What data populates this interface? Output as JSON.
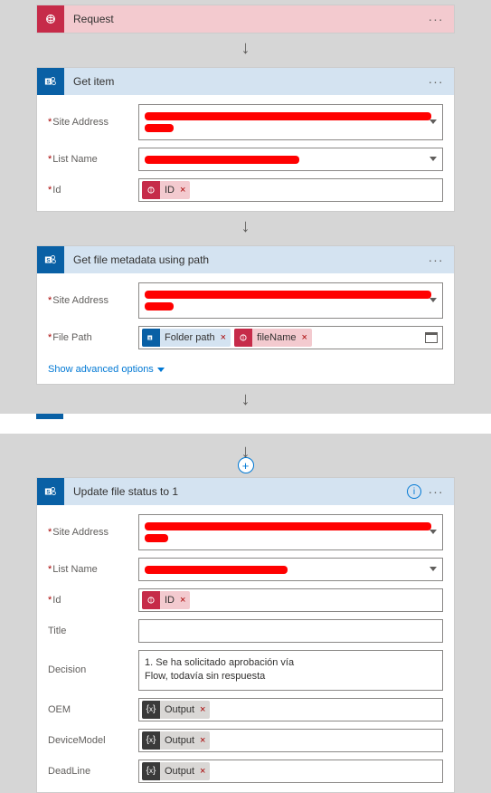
{
  "request": {
    "title": "Request"
  },
  "getItem": {
    "title": "Get item",
    "f_site": "Site Address",
    "f_list": "List Name",
    "f_id": "Id",
    "pill_id": "ID"
  },
  "getMeta": {
    "title": "Get file metadata using path",
    "f_site": "Site Address",
    "f_path": "File Path",
    "pill_folder": "Folder path",
    "pill_file": "fileName",
    "adv": "Show advanced options"
  },
  "update": {
    "title": "Update file status to 1",
    "f_site": "Site Address",
    "f_list": "List Name",
    "f_id": "Id",
    "f_title": "Title",
    "f_dec": "Decision",
    "f_oem": "OEM",
    "f_dev": "DeviceModel",
    "f_dead": "DeadLine",
    "pill_id": "ID",
    "pill_out": "Output",
    "dec_l1": "1. Se ha solicitado aprobación vía",
    "dec_l2": "Flow, todavía sin respuesta"
  }
}
